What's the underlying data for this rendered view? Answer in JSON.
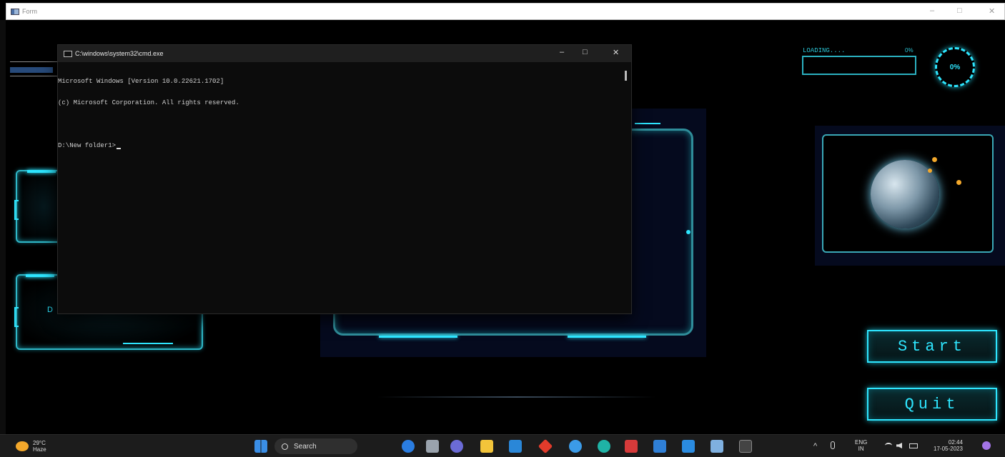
{
  "window": {
    "title": "Form",
    "minimize": "–",
    "maximize": "□",
    "close": "✕"
  },
  "form": {
    "loading": {
      "label": "LOADING....",
      "pct_small": "0%",
      "progress_fraction": 0.0
    },
    "ring": {
      "value": "0%"
    },
    "buttons": {
      "start": "Start",
      "quit": "Quit"
    },
    "left_panel_text": "D"
  },
  "cmd": {
    "title": "C:\\windows\\system32\\cmd.exe",
    "lines": [
      "Microsoft Windows [Version 10.0.22621.1702]",
      "(c) Microsoft Corporation. All rights reserved."
    ],
    "prompt": "D:\\New folder1>",
    "minimize": "–",
    "maximize": "□",
    "close": "✕"
  },
  "taskbar": {
    "weather": {
      "temp": "29°C",
      "desc": "Haze"
    },
    "search": "Search",
    "tray": {
      "lang": "ENG",
      "region": "IN",
      "time": "02:44",
      "date": "17-05-2023",
      "caret": "^"
    },
    "colors": {
      "accent": "#2ee6ff",
      "win_blue": "#3a8ee6"
    }
  }
}
